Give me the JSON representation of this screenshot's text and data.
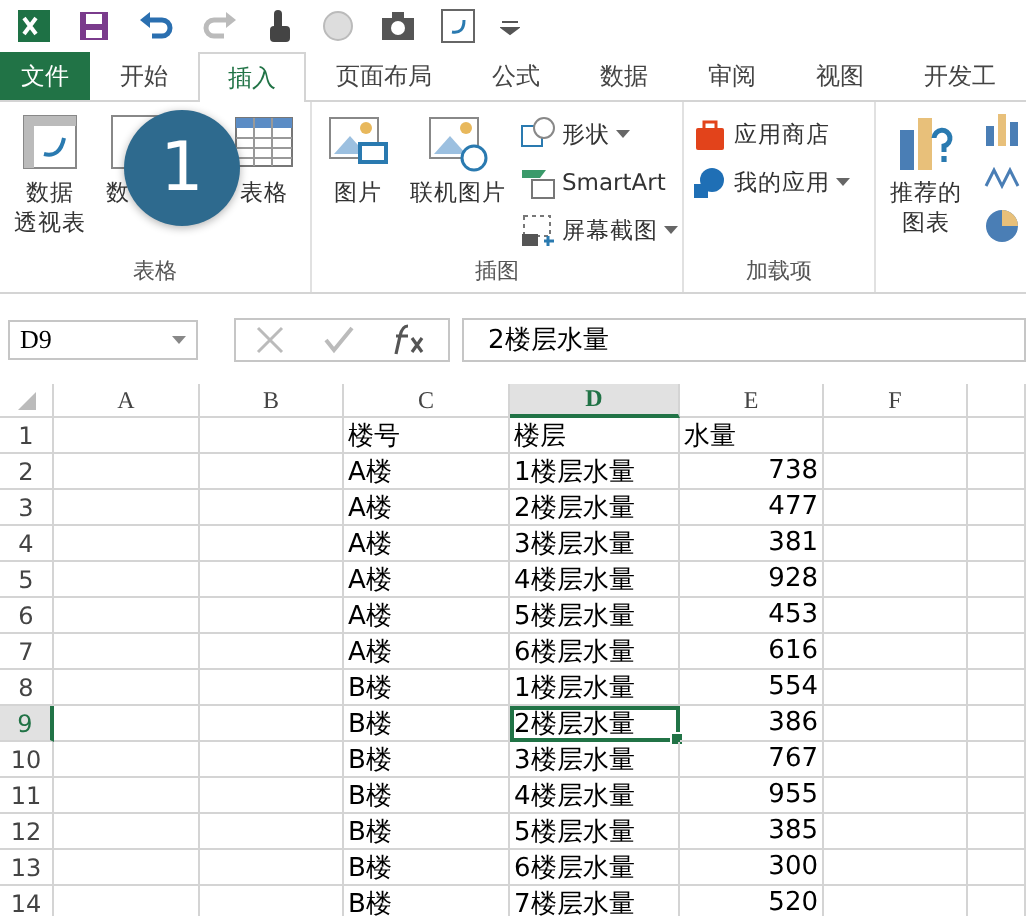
{
  "tabs": [
    {
      "label": "文件",
      "kind": "file",
      "selected": false
    },
    {
      "label": "开始",
      "kind": "normal",
      "selected": false
    },
    {
      "label": "插入",
      "kind": "normal",
      "selected": true
    },
    {
      "label": "页面布局",
      "kind": "normal",
      "selected": false
    },
    {
      "label": "公式",
      "kind": "normal",
      "selected": false
    },
    {
      "label": "数据",
      "kind": "normal",
      "selected": false
    },
    {
      "label": "审阅",
      "kind": "normal",
      "selected": false
    },
    {
      "label": "视图",
      "kind": "normal",
      "selected": false
    },
    {
      "label": "开发工",
      "kind": "normal",
      "selected": false
    }
  ],
  "ribbon": {
    "groups": [
      {
        "label": "表格",
        "items": [
          {
            "kind": "pivot",
            "lines": [
              "数据",
              "透视表"
            ]
          },
          {
            "kind": "recpivot",
            "lines": [
              "数"
            ]
          },
          {
            "kind": "table",
            "lines": [
              "表格"
            ]
          }
        ]
      },
      {
        "label": "插图",
        "items": [
          {
            "kind": "picture",
            "lines": [
              "图片"
            ]
          },
          {
            "kind": "online",
            "lines": [
              "联机图片"
            ]
          },
          {
            "kind": "small",
            "entries": [
              {
                "kind": "shapes",
                "label": "形状",
                "dropdown": true
              },
              {
                "kind": "smartart",
                "label": "SmartArt",
                "dropdown": false
              },
              {
                "kind": "screenshot",
                "label": "屏幕截图",
                "dropdown": true
              }
            ]
          }
        ]
      },
      {
        "label": "加载项",
        "items": [
          {
            "kind": "small",
            "entries": [
              {
                "kind": "store",
                "label": "应用商店",
                "dropdown": false
              },
              {
                "kind": "myapps",
                "label": "我的应用",
                "dropdown": true
              }
            ]
          }
        ]
      },
      {
        "items": [
          {
            "kind": "recchart",
            "lines": [
              "推荐的",
              "图表"
            ]
          },
          {
            "kind": "charticons"
          }
        ]
      }
    ]
  },
  "step_badge": "1",
  "formula_bar": {
    "name_box": "D9",
    "formula": "2楼层水量"
  },
  "sheet": {
    "columns": [
      {
        "label": "A",
        "selected": false
      },
      {
        "label": "B",
        "selected": false
      },
      {
        "label": "C",
        "selected": false
      },
      {
        "label": "D",
        "selected": true
      },
      {
        "label": "E",
        "selected": false
      },
      {
        "label": "F",
        "selected": false
      }
    ],
    "rows": [
      {
        "label": "1",
        "selected": false,
        "cells": [
          "",
          "",
          "楼号",
          "楼层",
          "水量",
          ""
        ]
      },
      {
        "label": "2",
        "selected": false,
        "cells": [
          "",
          "",
          "A楼",
          "1楼层水量",
          "738",
          ""
        ]
      },
      {
        "label": "3",
        "selected": false,
        "cells": [
          "",
          "",
          "A楼",
          "2楼层水量",
          "477",
          ""
        ]
      },
      {
        "label": "4",
        "selected": false,
        "cells": [
          "",
          "",
          "A楼",
          "3楼层水量",
          "381",
          ""
        ]
      },
      {
        "label": "5",
        "selected": false,
        "cells": [
          "",
          "",
          "A楼",
          "4楼层水量",
          "928",
          ""
        ]
      },
      {
        "label": "6",
        "selected": false,
        "cells": [
          "",
          "",
          "A楼",
          "5楼层水量",
          "453",
          ""
        ]
      },
      {
        "label": "7",
        "selected": false,
        "cells": [
          "",
          "",
          "A楼",
          "6楼层水量",
          "616",
          ""
        ]
      },
      {
        "label": "8",
        "selected": false,
        "cells": [
          "",
          "",
          "B楼",
          "1楼层水量",
          "554",
          ""
        ]
      },
      {
        "label": "9",
        "selected": true,
        "cells": [
          "",
          "",
          "B楼",
          "2楼层水量",
          "386",
          ""
        ]
      },
      {
        "label": "10",
        "selected": false,
        "cells": [
          "",
          "",
          "B楼",
          "3楼层水量",
          "767",
          ""
        ]
      },
      {
        "label": "11",
        "selected": false,
        "cells": [
          "",
          "",
          "B楼",
          "4楼层水量",
          "955",
          ""
        ]
      },
      {
        "label": "12",
        "selected": false,
        "cells": [
          "",
          "",
          "B楼",
          "5楼层水量",
          "385",
          ""
        ]
      },
      {
        "label": "13",
        "selected": false,
        "cells": [
          "",
          "",
          "B楼",
          "6楼层水量",
          "300",
          ""
        ]
      },
      {
        "label": "14",
        "selected": false,
        "cells": [
          "",
          "",
          "B楼",
          "7楼层水量",
          "520",
          ""
        ]
      }
    ]
  }
}
